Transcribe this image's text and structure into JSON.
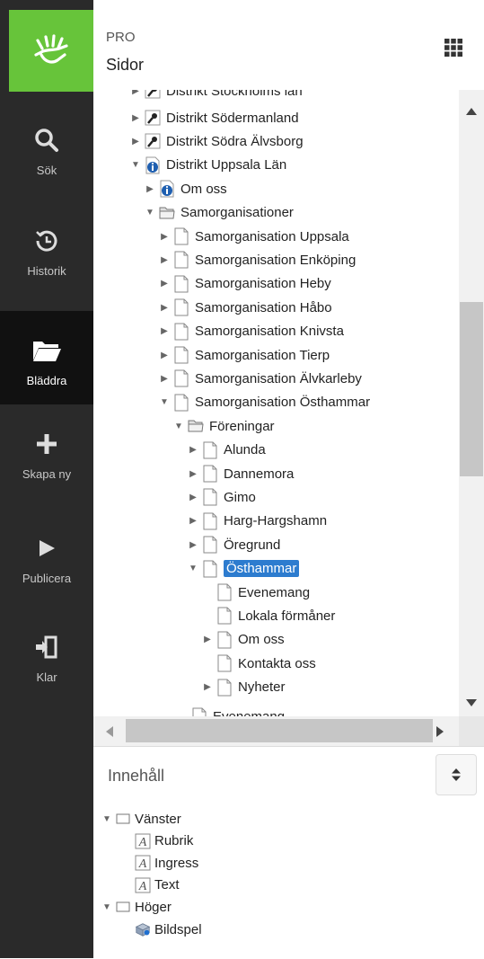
{
  "app": {
    "badge": "PRO",
    "title": "Sidor"
  },
  "sidebar": {
    "items": [
      {
        "label": "Sök",
        "icon": "search-icon"
      },
      {
        "label": "Historik",
        "icon": "history-icon"
      },
      {
        "label": "Bläddra",
        "icon": "folder-icon"
      },
      {
        "label": "Skapa ny",
        "icon": "plus-icon"
      },
      {
        "label": "Publicera",
        "icon": "play-icon"
      },
      {
        "label": "Klar",
        "icon": "exit-icon"
      }
    ]
  },
  "tree": {
    "partial_top": "Distrikt Stockholms län",
    "rows": [
      {
        "label": "Distrikt Södermanland",
        "level": 0,
        "toggle": "collapsed",
        "icon": "key-icon"
      },
      {
        "label": "Distrikt Södra Älvsborg",
        "level": 0,
        "toggle": "collapsed",
        "icon": "key-icon"
      },
      {
        "label": "Distrikt Uppsala Län",
        "level": 0,
        "toggle": "expanded",
        "icon": "info-page-icon"
      },
      {
        "label": "Om oss",
        "level": 1,
        "toggle": "collapsed",
        "icon": "info-page-icon"
      },
      {
        "label": "Samorganisationer",
        "level": 1,
        "toggle": "expanded",
        "icon": "folder-icon"
      },
      {
        "label": "Samorganisation Uppsala",
        "level": 2,
        "toggle": "collapsed",
        "icon": "page-icon"
      },
      {
        "label": "Samorganisation Enköping",
        "level": 2,
        "toggle": "collapsed",
        "icon": "page-icon"
      },
      {
        "label": "Samorganisation Heby",
        "level": 2,
        "toggle": "collapsed",
        "icon": "page-icon"
      },
      {
        "label": "Samorganisation Håbo",
        "level": 2,
        "toggle": "collapsed",
        "icon": "page-icon"
      },
      {
        "label": "Samorganisation Knivsta",
        "level": 2,
        "toggle": "collapsed",
        "icon": "page-icon"
      },
      {
        "label": "Samorganisation Tierp",
        "level": 2,
        "toggle": "collapsed",
        "icon": "page-icon"
      },
      {
        "label": "Samorganisation Älvkarleby",
        "level": 2,
        "toggle": "collapsed",
        "icon": "page-icon"
      },
      {
        "label": "Samorganisation Östhammar",
        "level": 2,
        "toggle": "expanded",
        "icon": "page-icon"
      },
      {
        "label": "Föreningar",
        "level": 3,
        "toggle": "expanded",
        "icon": "folder-icon"
      },
      {
        "label": "Alunda",
        "level": 4,
        "toggle": "collapsed",
        "icon": "page-icon"
      },
      {
        "label": "Dannemora",
        "level": 4,
        "toggle": "collapsed",
        "icon": "page-icon"
      },
      {
        "label": "Gimo",
        "level": 4,
        "toggle": "collapsed",
        "icon": "page-icon"
      },
      {
        "label": "Harg-Hargshamn",
        "level": 4,
        "toggle": "collapsed",
        "icon": "page-icon"
      },
      {
        "label": "Öregrund",
        "level": 4,
        "toggle": "collapsed",
        "icon": "page-icon"
      },
      {
        "label": "Östhammar",
        "level": 4,
        "toggle": "expanded",
        "icon": "page-icon",
        "selected": true
      },
      {
        "label": "Evenemang",
        "level": 5,
        "toggle": "none",
        "icon": "page-icon"
      },
      {
        "label": "Lokala förmåner",
        "level": 5,
        "toggle": "none",
        "icon": "page-icon"
      },
      {
        "label": "Om oss",
        "level": 5,
        "toggle": "collapsed",
        "icon": "page-icon"
      },
      {
        "label": "Kontakta oss",
        "level": 5,
        "toggle": "none",
        "icon": "page-icon"
      },
      {
        "label": "Nyheter",
        "level": 5,
        "toggle": "collapsed",
        "icon": "page-icon"
      }
    ],
    "partial_bottom": "Evenemang"
  },
  "content": {
    "title": "Innehåll",
    "rows": [
      {
        "label": "Vänster",
        "level": 0,
        "toggle": "expanded",
        "icon": "area-icon"
      },
      {
        "label": "Rubrik",
        "level": 1,
        "toggle": "none",
        "icon": "text-block-icon"
      },
      {
        "label": "Ingress",
        "level": 1,
        "toggle": "none",
        "icon": "text-block-icon"
      },
      {
        "label": "Text",
        "level": 1,
        "toggle": "none",
        "icon": "text-block-icon"
      },
      {
        "label": "Höger",
        "level": 0,
        "toggle": "expanded",
        "icon": "area-icon"
      },
      {
        "label": "Bildspel",
        "level": 1,
        "toggle": "none",
        "icon": "slideshow-icon"
      }
    ]
  },
  "colors": {
    "brand": "#67c43a",
    "sidebar": "#2a2a2a",
    "selection": "#2d7ccf"
  }
}
